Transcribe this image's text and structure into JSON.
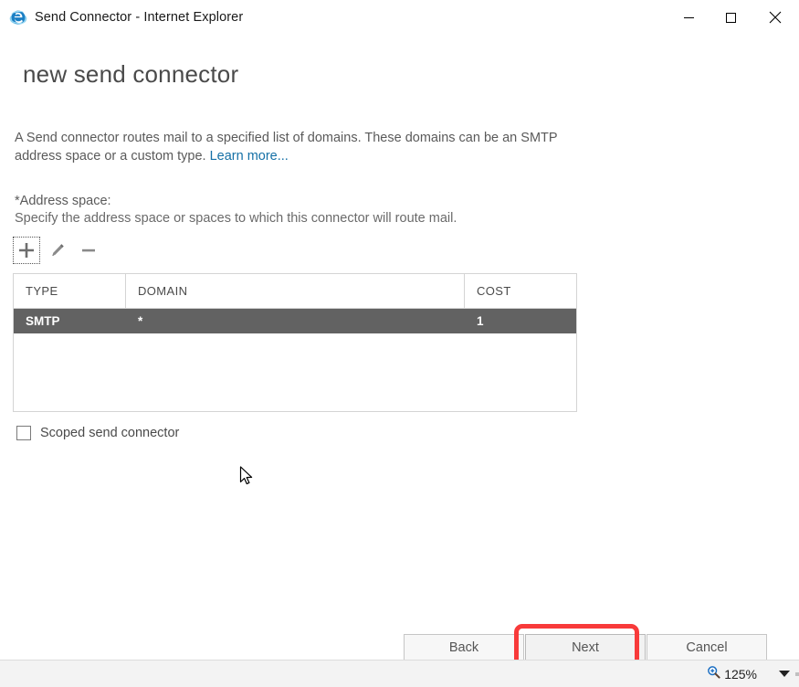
{
  "window": {
    "title": "Send Connector - Internet Explorer",
    "app_icon": "internet-explorer-icon",
    "controls": {
      "minimize": "Minimize",
      "maximize": "Maximize",
      "close": "Close"
    }
  },
  "page": {
    "heading": "new send connector",
    "description_text": "A Send connector routes mail to a specified list of domains. These domains can be an SMTP address space or a custom type. ",
    "learn_more": "Learn more...",
    "field_label": "*Address space:",
    "field_hint": "Specify the address space or spaces to which this connector will route mail."
  },
  "toolbar": {
    "add_label": "Add",
    "add_icon": "plus-icon",
    "edit_label": "Edit",
    "edit_icon": "pencil-icon",
    "remove_label": "Remove",
    "remove_icon": "minus-icon"
  },
  "grid": {
    "columns": [
      "TYPE",
      "DOMAIN",
      "COST"
    ],
    "rows": [
      {
        "type": "SMTP",
        "domain": "*",
        "cost": "1",
        "selected": true
      }
    ]
  },
  "options": {
    "scoped_send_connector_label": "Scoped send connector",
    "scoped_send_connector_checked": false
  },
  "buttons": {
    "back": "Back",
    "next": "Next",
    "cancel": "Cancel"
  },
  "annotation": {
    "highlight_color": "#f83a3a",
    "highlight_target": "next-button"
  },
  "statusbar": {
    "zoom_icon": "magnifier-zoom-icon",
    "zoom_level": "125%",
    "zoom_caret_icon": "chevron-down-icon"
  },
  "colors": {
    "link": "#1570a6",
    "selected_row_bg": "#626262",
    "grid_border": "#d4d4d4"
  }
}
